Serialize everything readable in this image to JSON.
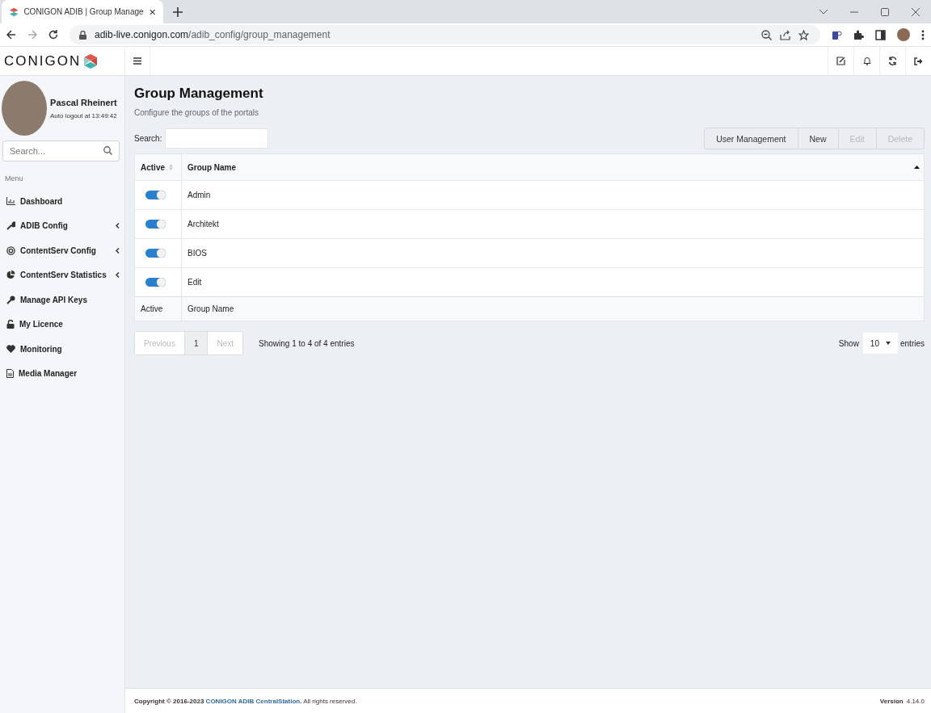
{
  "browser": {
    "tab_title": "CONIGON ADIB | Group Manage",
    "url_host": "adib-live.conigon.com",
    "url_path": "/adib_config/group_management"
  },
  "app": {
    "logo": "CONIGON"
  },
  "user": {
    "name": "Pascal Rheinert",
    "auto_logout": "Auto logout at 13:49:42"
  },
  "sidebar": {
    "search_placeholder": "Search...",
    "menu_label": "Menu",
    "items": [
      {
        "label": "Dashboard",
        "submenu": false
      },
      {
        "label": "ADIB Config",
        "submenu": true
      },
      {
        "label": "ContentServ Config",
        "submenu": true
      },
      {
        "label": "ContentServ Statistics",
        "submenu": true
      },
      {
        "label": "Manage API Keys",
        "submenu": false
      },
      {
        "label": "My Licence",
        "submenu": false
      },
      {
        "label": "Monitoring",
        "submenu": false
      },
      {
        "label": "Media Manager",
        "submenu": false
      }
    ]
  },
  "page": {
    "title": "Group Management",
    "subtitle": "Configure the groups of the portals"
  },
  "search_label": "Search:",
  "buttons": [
    {
      "label": "User Management",
      "disabled": false
    },
    {
      "label": "New",
      "disabled": false
    },
    {
      "label": "Edit",
      "disabled": true
    },
    {
      "label": "Delete",
      "disabled": true
    }
  ],
  "table": {
    "columns": [
      "Active",
      "Group Name"
    ],
    "rows": [
      {
        "active": true,
        "name": "Admin"
      },
      {
        "active": true,
        "name": "Architekt"
      },
      {
        "active": true,
        "name": "BIOS"
      },
      {
        "active": true,
        "name": "Edit"
      }
    ],
    "footer": [
      "Active",
      "Group Name"
    ]
  },
  "pagination": {
    "previous": "Previous",
    "previous_disabled": true,
    "pages": [
      {
        "label": "1",
        "selected": true
      }
    ],
    "next": "Next",
    "next_disabled": true,
    "info": "Showing 1 to 4 of 4 entries"
  },
  "length": {
    "show": "Show",
    "value": "10",
    "entries": "entries"
  },
  "footer": {
    "copyright": "Copyright © 2016-2023",
    "link": "CONIGON ADIB CentralStation.",
    "rights": "All rights reserved.",
    "version_label": "Version",
    "version": "4.14.0"
  }
}
